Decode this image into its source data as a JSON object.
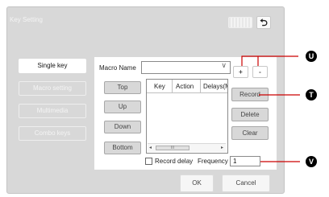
{
  "dialog": {
    "title": "Key Setting",
    "back_icon": "return-icon",
    "back_glyph": "⮌"
  },
  "sidebar": {
    "items": [
      {
        "label": "Single key",
        "active": true
      },
      {
        "label": "Macro setting",
        "active": false
      },
      {
        "label": "Multimedia",
        "active": false
      },
      {
        "label": "Combo keys",
        "active": false
      }
    ]
  },
  "macro": {
    "name_label": "Macro Name",
    "name_value": "",
    "dropdown_glyph": "∨",
    "add_label": "+",
    "remove_label": "-",
    "move_buttons": {
      "top": "Top",
      "up": "Up",
      "down": "Down",
      "bottom": "Bottom"
    },
    "columns": [
      "Key",
      "Action",
      "Delays(M"
    ],
    "scroll": {
      "left": "◂",
      "right": "▸",
      "thumb": "III"
    },
    "actions": {
      "record": "Record",
      "delete": "Delete",
      "clear": "Clear"
    },
    "record_delay_label": "Record delay",
    "record_delay_checked": false,
    "frequency_label": "Frequency",
    "frequency_value": "1"
  },
  "footer": {
    "ok": "OK",
    "cancel": "Cancel"
  },
  "callouts": {
    "u": "U",
    "t": "T",
    "v": "V"
  },
  "colors": {
    "callout": "#cc0000",
    "panel": "#d8d8d8"
  }
}
